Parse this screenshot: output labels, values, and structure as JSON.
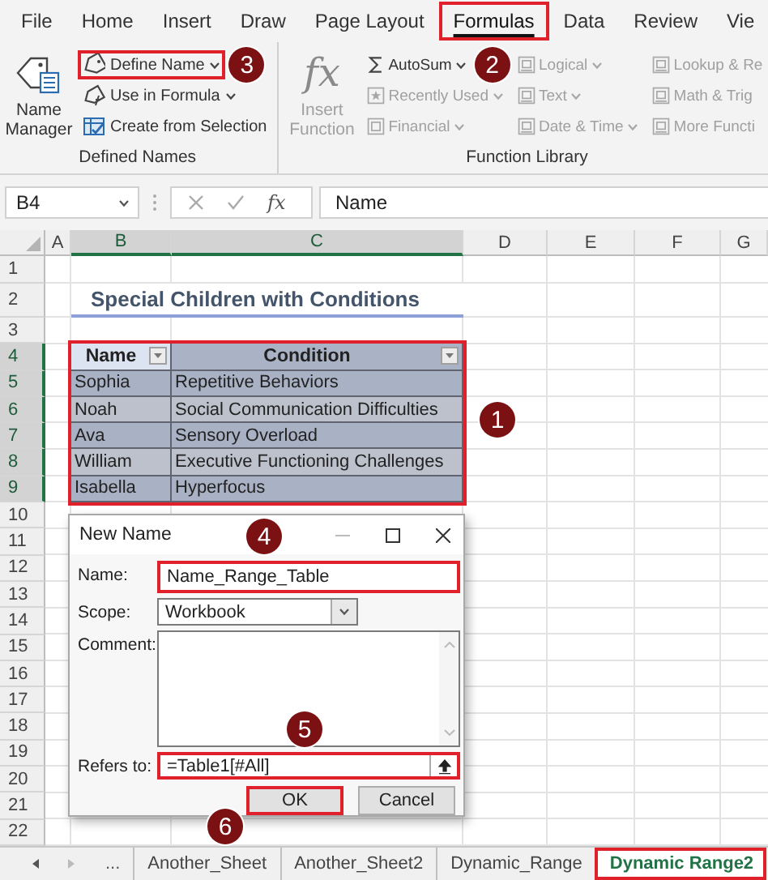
{
  "ribbon_tabs": [
    {
      "label": "File",
      "selected": false,
      "highlighted": false
    },
    {
      "label": "Home",
      "selected": false,
      "highlighted": false
    },
    {
      "label": "Insert",
      "selected": false,
      "highlighted": false
    },
    {
      "label": "Draw",
      "selected": false,
      "highlighted": false
    },
    {
      "label": "Page Layout",
      "selected": false,
      "highlighted": false
    },
    {
      "label": "Formulas",
      "selected": true,
      "highlighted": true
    },
    {
      "label": "Data",
      "selected": false,
      "highlighted": false
    },
    {
      "label": "Review",
      "selected": false,
      "highlighted": false
    },
    {
      "label": "Vie",
      "selected": false,
      "highlighted": false
    }
  ],
  "ribbon_groups": [
    {
      "label": "Defined Names",
      "big_button": {
        "kind": "name-manager",
        "label": "Name Manager",
        "disabled": false
      },
      "commands": [
        {
          "kind": "tag",
          "label": "Define Name",
          "dropdown": true,
          "disabled": false,
          "highlighted": true,
          "badge": "3"
        },
        {
          "kind": "formula",
          "label": "Use in Formula",
          "dropdown": true,
          "disabled": false,
          "highlighted": false
        },
        {
          "kind": "selection",
          "label": "Create from Selection",
          "dropdown": false,
          "disabled": false,
          "highlighted": false
        }
      ]
    },
    {
      "label": "Function Library",
      "big_button": {
        "kind": "fx",
        "icon_text": "fx",
        "label": "Insert Function",
        "disabled": true
      },
      "commands": [
        {
          "kind": "sum",
          "label": "AutoSum",
          "dropdown": true,
          "disabled": false,
          "highlighted": false,
          "badge": "2"
        },
        {
          "kind": "star",
          "label": "Recently Used",
          "dropdown": true,
          "disabled": true,
          "highlighted": false
        },
        {
          "kind": "book",
          "label": "Financial",
          "dropdown": true,
          "disabled": true,
          "highlighted": false
        },
        {
          "kind": "category",
          "label": "Logical",
          "dropdown": true,
          "disabled": true,
          "highlighted": false
        },
        {
          "kind": "category",
          "label": "Text",
          "dropdown": true,
          "disabled": true,
          "highlighted": false
        },
        {
          "kind": "category",
          "label": "Date & Time",
          "dropdown": true,
          "disabled": true,
          "highlighted": false
        },
        {
          "kind": "category",
          "label": "Lookup & Re",
          "dropdown": false,
          "disabled": true,
          "highlighted": false
        },
        {
          "kind": "category",
          "label": "Math & Trig",
          "dropdown": false,
          "disabled": true,
          "highlighted": false
        },
        {
          "kind": "category",
          "label": "More Functi",
          "dropdown": false,
          "disabled": true,
          "highlighted": false
        }
      ]
    }
  ],
  "formula_bar": {
    "name_box": "B4",
    "function_glyph": "fx",
    "formula": "Name"
  },
  "sheet": {
    "columns": [
      {
        "label": "A",
        "selected": false
      },
      {
        "label": "B",
        "selected": true
      },
      {
        "label": "C",
        "selected": true
      },
      {
        "label": "D",
        "selected": false
      },
      {
        "label": "E",
        "selected": false
      },
      {
        "label": "F",
        "selected": false
      },
      {
        "label": "G",
        "selected": false
      }
    ],
    "rows": [
      {
        "number": "1",
        "selected": false
      },
      {
        "number": "2",
        "selected": false
      },
      {
        "number": "3",
        "selected": false
      },
      {
        "number": "4",
        "selected": true
      },
      {
        "number": "5",
        "selected": true
      },
      {
        "number": "6",
        "selected": true
      },
      {
        "number": "7",
        "selected": true
      },
      {
        "number": "8",
        "selected": true
      },
      {
        "number": "9",
        "selected": true
      },
      {
        "number": "10",
        "selected": false
      },
      {
        "number": "11",
        "selected": false
      },
      {
        "number": "12",
        "selected": false
      },
      {
        "number": "13",
        "selected": false
      },
      {
        "number": "14",
        "selected": false
      },
      {
        "number": "15",
        "selected": false
      },
      {
        "number": "16",
        "selected": false
      },
      {
        "number": "17",
        "selected": false
      },
      {
        "number": "18",
        "selected": false
      },
      {
        "number": "19",
        "selected": false
      },
      {
        "number": "20",
        "selected": false
      },
      {
        "number": "21",
        "selected": false
      },
      {
        "number": "22",
        "selected": false
      }
    ],
    "title": "Special Children with Conditions",
    "table": {
      "highlighted": true,
      "badge": "1",
      "columns": [
        {
          "label": "Name",
          "active": true
        },
        {
          "label": "Condition",
          "active": false
        }
      ],
      "rows": [
        {
          "name": "Sophia",
          "condition": "Repetitive Behaviors"
        },
        {
          "name": "Noah",
          "condition": "Social Communication Difficulties"
        },
        {
          "name": "Ava",
          "condition": "Sensory Overload"
        },
        {
          "name": "William",
          "condition": "Executive Functioning Challenges"
        },
        {
          "name": "Isabella",
          "condition": "Hyperfocus"
        }
      ]
    }
  },
  "dialog": {
    "title": "New Name",
    "badge": "4",
    "fields": [
      {
        "kind": "text",
        "label": "Name:",
        "value": "Name_Range_Table",
        "highlighted": true
      },
      {
        "kind": "dropdown",
        "label": "Scope:",
        "value": "Workbook",
        "highlighted": false
      },
      {
        "kind": "textarea",
        "label": "Comment:",
        "highlighted": false
      },
      {
        "kind": "reference",
        "label": "Refers to:",
        "value": "=Table1[#All]",
        "highlighted": true,
        "badge": "5"
      }
    ],
    "buttons": [
      {
        "label": "OK",
        "highlighted": true,
        "badge": "6"
      },
      {
        "label": "Cancel",
        "highlighted": false
      }
    ]
  },
  "sheet_tabs": {
    "overflow": "...",
    "tabs": [
      {
        "label": "Another_Sheet",
        "selected": false,
        "highlighted": false
      },
      {
        "label": "Another_Sheet2",
        "selected": false,
        "highlighted": false
      },
      {
        "label": "Dynamic_Range",
        "selected": false,
        "highlighted": false
      },
      {
        "label": "Dynamic Range2",
        "selected": true,
        "highlighted": true
      }
    ]
  }
}
